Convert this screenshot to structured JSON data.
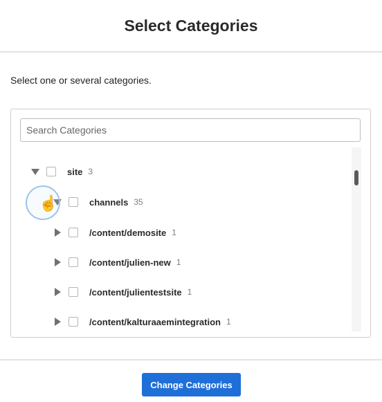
{
  "dialog": {
    "title": "Select Categories"
  },
  "instruction": "Select one or several categories.",
  "search": {
    "placeholder": "Search Categories",
    "value": ""
  },
  "tree": {
    "nodes": [
      {
        "label": "site",
        "count": "3",
        "expanded": true
      },
      {
        "label": "channels",
        "count": "35",
        "expanded": true
      },
      {
        "label": "/content/demosite",
        "count": "1",
        "expanded": false
      },
      {
        "label": "/content/julien-new",
        "count": "1",
        "expanded": false
      },
      {
        "label": "/content/julientestsite",
        "count": "1",
        "expanded": false
      },
      {
        "label": "/content/kalturaaemintegration",
        "count": "1",
        "expanded": false
      }
    ]
  },
  "footer": {
    "button_label": "Change Categories"
  },
  "colors": {
    "accent": "#1f6fd9",
    "text": "#2a2a2a",
    "muted": "#7d7d7d"
  }
}
